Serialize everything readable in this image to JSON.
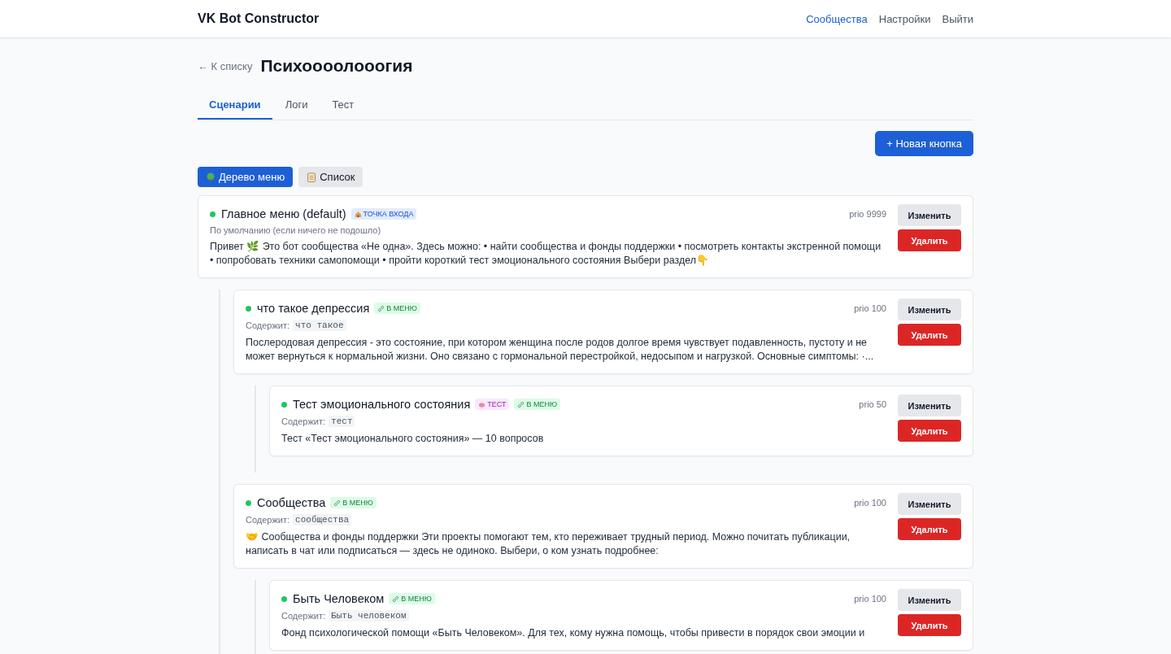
{
  "header": {
    "brand": "VK Bot Constructor",
    "nav": [
      {
        "label": "Сообщества",
        "selected": true
      },
      {
        "label": "Настройки",
        "selected": false
      },
      {
        "label": "Выйти",
        "selected": false
      }
    ]
  },
  "back_link": "← К списку",
  "page_title": "Психоооолооогия",
  "tabs": [
    {
      "label": "Сценарии",
      "selected": true
    },
    {
      "label": "Логи",
      "selected": false
    },
    {
      "label": "Тест",
      "selected": false
    }
  ],
  "new_button": "+ Новая кнопка",
  "views": [
    {
      "label": "Дерево меню",
      "kind": "tree",
      "selected": true
    },
    {
      "label": "Список",
      "kind": "list",
      "selected": false
    }
  ],
  "nodes": [
    {
      "title": "Главное меню (default)",
      "active": true,
      "badges": [
        {
          "kind": "entry",
          "text": "ТОЧКА ВХОДА"
        }
      ],
      "subtitle": {
        "kind": "note",
        "text": "По умолчанию (если ничего не подошло)"
      },
      "text": "Привет 🌿 Это бот сообщества «Не одна». Здесь можно: • найти сообщества и фонды поддержки • посмотреть контакты экстренной помощи • попробовать техники самопомощи • пройти короткий тест эмоционального состояния Выбери раздел👇",
      "prio": "prio 9999",
      "edit": "Изменить",
      "delete": "Удалить",
      "children": [
        {
          "title": "что такое депрессия",
          "active": true,
          "badges": [
            {
              "kind": "menu",
              "text": "В МЕНЮ"
            }
          ],
          "subtitle": {
            "kind": "contains",
            "label": "Содержит:",
            "text": "что такое"
          },
          "text": "Послеродовая депрессия - это состояние, при котором женщина после родов долгое время чувствует подавленность, пустоту и не может вернуться к нормальной жизни. Оно связано с гормональной перестройкой, недосыпом и нагрузкой. Основные симптомы: ·...",
          "prio": "prio 100",
          "edit": "Изменить",
          "delete": "Удалить",
          "children": [
            {
              "title": "Тест эмоционального состояния",
              "active": true,
              "badges": [
                {
                  "kind": "test",
                  "text": "ТЕСТ"
                },
                {
                  "kind": "menu",
                  "text": "В МЕНЮ"
                }
              ],
              "subtitle": {
                "kind": "contains",
                "label": "Содержит:",
                "text": "тест"
              },
              "text": "Тест «Тест эмоционального состояния» — 10 вопросов",
              "prio": "prio 50",
              "edit": "Изменить",
              "delete": "Удалить"
            }
          ]
        },
        {
          "title": "Сообщества",
          "active": true,
          "badges": [
            {
              "kind": "menu",
              "text": "В МЕНЮ"
            }
          ],
          "subtitle": {
            "kind": "contains",
            "label": "Содержит:",
            "text": "сообщества"
          },
          "text": "🤝 Сообщества и фонды поддержки Эти проекты помогают тем, кто переживает трудный период. Можно почитать публикации, написать в чат или подписаться — здесь не одиноко. Выбери, о ком узнать подробнее:",
          "prio": "prio 100",
          "edit": "Изменить",
          "delete": "Удалить",
          "children": [
            {
              "title": "Быть Человеком",
              "active": true,
              "badges": [
                {
                  "kind": "menu",
                  "text": "В МЕНЮ"
                }
              ],
              "subtitle": {
                "kind": "contains",
                "label": "Содержит:",
                "text": "Быть человеком"
              },
              "text": "Фонд психологической помощи «Быть Человеком». Для тех, кому нужна помощь, чтобы привести в порядок свои эмоции и",
              "prio": "prio 100",
              "edit": "Изменить",
              "delete": "Удалить"
            }
          ]
        }
      ]
    }
  ]
}
